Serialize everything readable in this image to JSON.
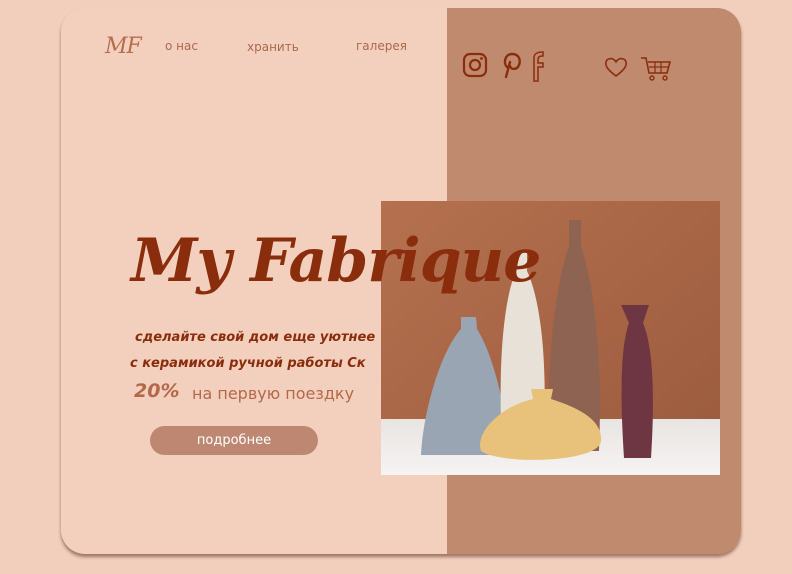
{
  "logo": "MF",
  "nav": {
    "about": "о нас",
    "store": "хранить",
    "gallery": "галерея"
  },
  "social": {
    "instagram": "instagram-icon",
    "pinterest": "pinterest-icon",
    "facebook": "facebook-icon"
  },
  "actions": {
    "favorites": "heart-icon",
    "cart": "cart-icon"
  },
  "hero": {
    "title": "My Fabrique",
    "line1": "сделайте свой дом еще уютнее",
    "line2": "с керамикой ручной работы Ск",
    "discount": "20%",
    "offer": "на первую поездку",
    "button": "подробнее"
  },
  "colors": {
    "background": "#f2cfbc",
    "card": "#f3d0bd",
    "panel": "#c08a6e",
    "title": "#8a2d0c",
    "accent": "#b3684a",
    "button": "#be8771"
  }
}
